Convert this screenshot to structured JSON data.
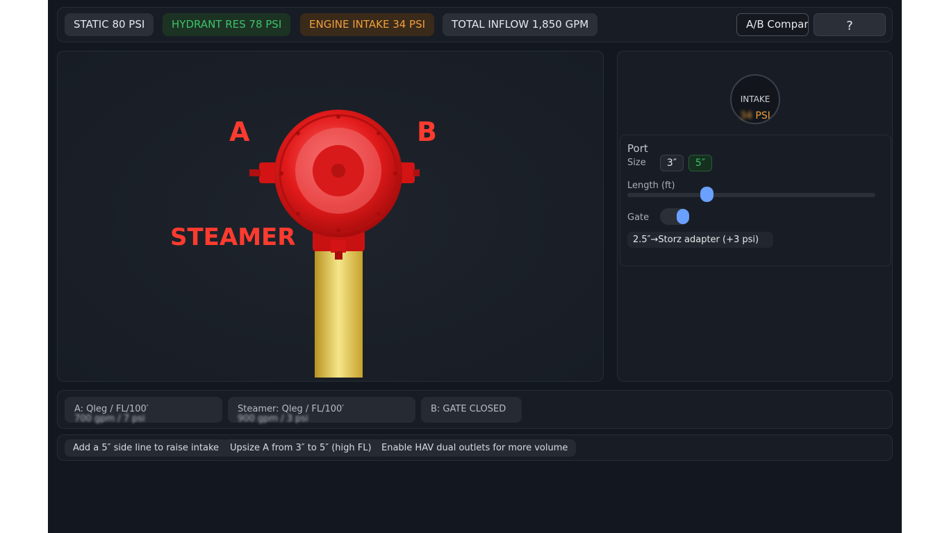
{
  "topbar": {
    "static_pill": "STATIC 80 PSI",
    "hydrant_pill": "HYDRANT RES 78 PSI",
    "intake_pill": "ENGINE INTAKE 34 PSI",
    "inflow_pill": "TOTAL INFLOW 1,850 GPM",
    "compare_button": "A/B Compare",
    "help_button": "?"
  },
  "stage": {
    "port_a_label": "A",
    "port_b_label": "B",
    "steamer_label": "STEAMER",
    "hydrant_color": "#e01515",
    "pipe_color": "#e0c040"
  },
  "side": {
    "gauge_label": "INTAKE",
    "gauge_value": "34",
    "gauge_unit": "PSI",
    "port_card": {
      "title": "Port",
      "size_label": "Size",
      "size_options": [
        "3″",
        "5″"
      ],
      "selected_size": "5″",
      "length_label": "Length (ft)",
      "length_fraction": 0.32,
      "gate_label": "Gate",
      "gate_on": true,
      "adapter_chip": "2.5″→Storz adapter (+3 psi)"
    }
  },
  "readouts": [
    {
      "label": "A: Qleg / FL/100′",
      "value": "700 gpm / 7 psi"
    },
    {
      "label": "Steamer: Qleg / FL/100′",
      "value": "900 gpm / 3 psi"
    },
    {
      "label": "B: GATE CLOSED",
      "value": ""
    }
  ],
  "suggestions": [
    "Add a 5″ side line to raise intake",
    "Upsize A from 3″ to 5″ (high FL)",
    "Enable HAV dual outlets for more volume"
  ],
  "colors": {
    "accent_blue": "#6aa0ff",
    "good_green": "#3ec26a",
    "warn_orange": "#f0a03c",
    "label_red": "#ff3b30"
  }
}
